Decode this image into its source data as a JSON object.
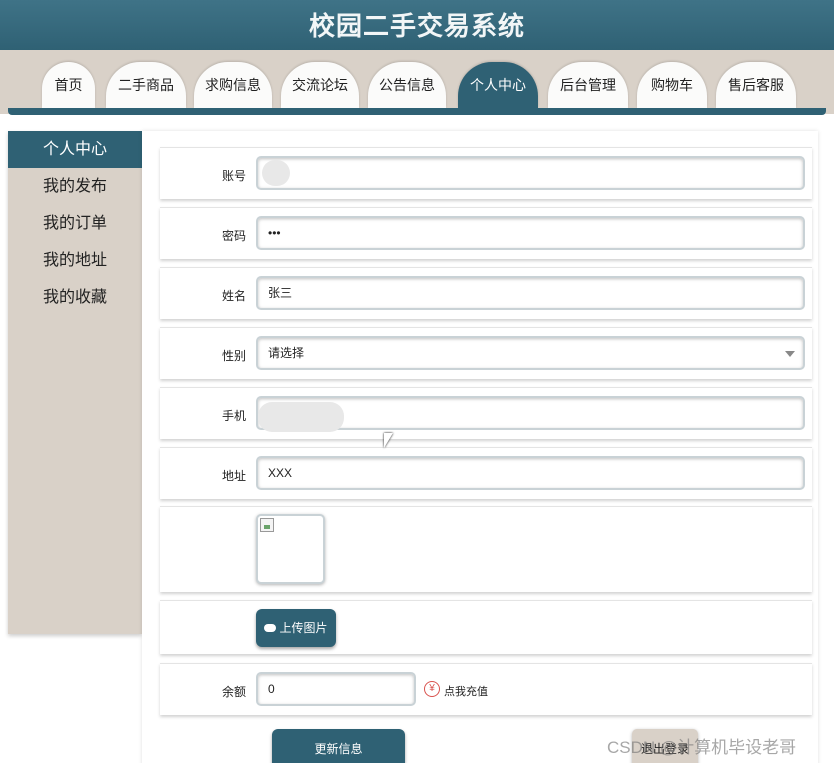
{
  "app": {
    "title": "校园二手交易系统"
  },
  "nav": {
    "tabs": [
      {
        "label": "首页"
      },
      {
        "label": "二手商品"
      },
      {
        "label": "求购信息"
      },
      {
        "label": "交流论坛"
      },
      {
        "label": "公告信息"
      },
      {
        "label": "个人中心",
        "active": true
      },
      {
        "label": "后台管理"
      },
      {
        "label": "购物车"
      },
      {
        "label": "售后客服"
      }
    ]
  },
  "sidebar": {
    "items": [
      {
        "label": "个人中心",
        "active": true
      },
      {
        "label": "我的发布"
      },
      {
        "label": "我的订单"
      },
      {
        "label": "我的地址"
      },
      {
        "label": "我的收藏"
      }
    ]
  },
  "form": {
    "account": {
      "label": "账号",
      "value": ""
    },
    "password": {
      "label": "密码",
      "value": "•••"
    },
    "name": {
      "label": "姓名",
      "value": "张三"
    },
    "gender": {
      "label": "性别",
      "value": "请选择"
    },
    "phone": {
      "label": "手机",
      "value": ""
    },
    "address": {
      "label": "地址",
      "value": "XXX"
    },
    "upload_label": "上传图片",
    "balance": {
      "label": "余额",
      "value": "0"
    },
    "recharge_label": "点我充值",
    "update_label": "更新信息",
    "logout_label": "退出登录"
  },
  "icons": {
    "cloud": "cloud-upload-icon",
    "yen": "yen-icon",
    "arrow": "chevron-down-icon"
  },
  "colors": {
    "primary": "#2f6174",
    "beige": "#d9d1c8",
    "danger": "#d9534f"
  },
  "watermark": "CSDN @计算机毕设老哥"
}
